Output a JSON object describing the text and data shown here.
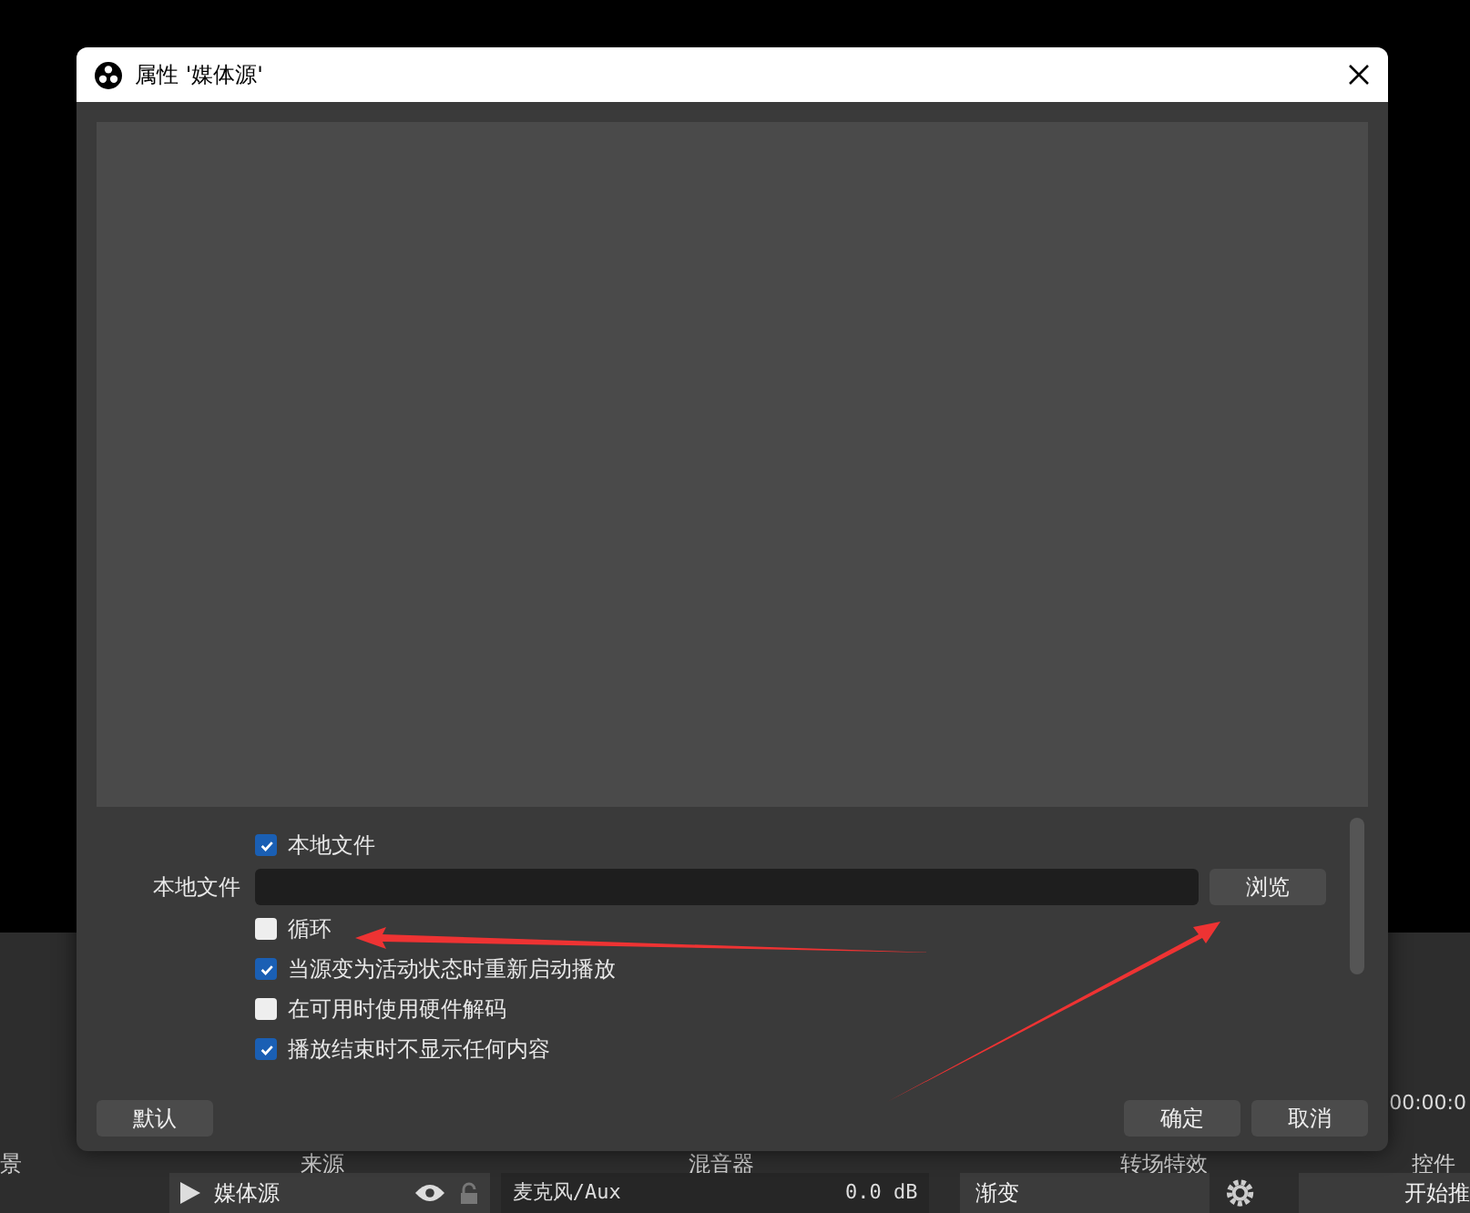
{
  "dialog": {
    "title": "属性 '媒体源'",
    "properties": [
      {
        "kind": "checkbox",
        "label": "本地文件",
        "checked": true
      },
      {
        "kind": "file",
        "label": "本地文件",
        "button": "浏览"
      },
      {
        "kind": "checkbox",
        "label": "循环",
        "checked": false
      },
      {
        "kind": "checkbox",
        "label": "当源变为活动状态时重新启动播放",
        "checked": true
      },
      {
        "kind": "checkbox",
        "label": "在可用时使用硬件解码",
        "checked": false
      },
      {
        "kind": "checkbox",
        "label": "播放结束时不显示任何内容",
        "checked": true
      }
    ],
    "buttons_left": [
      "默认"
    ],
    "buttons_right": [
      "确定",
      "取消"
    ]
  },
  "main_window": {
    "timer": "00:00:0",
    "docks": [
      {
        "title": "景"
      },
      {
        "title": "来源"
      },
      {
        "title": "混音器"
      },
      {
        "title": "转场特效"
      },
      {
        "title": "控件"
      }
    ],
    "source": {
      "name": "媒体源"
    },
    "mixer": {
      "name": "麦克风/Aux",
      "reading": "0.0 dB"
    },
    "transition": {
      "value": "渐变"
    },
    "start_button": "开始推"
  }
}
